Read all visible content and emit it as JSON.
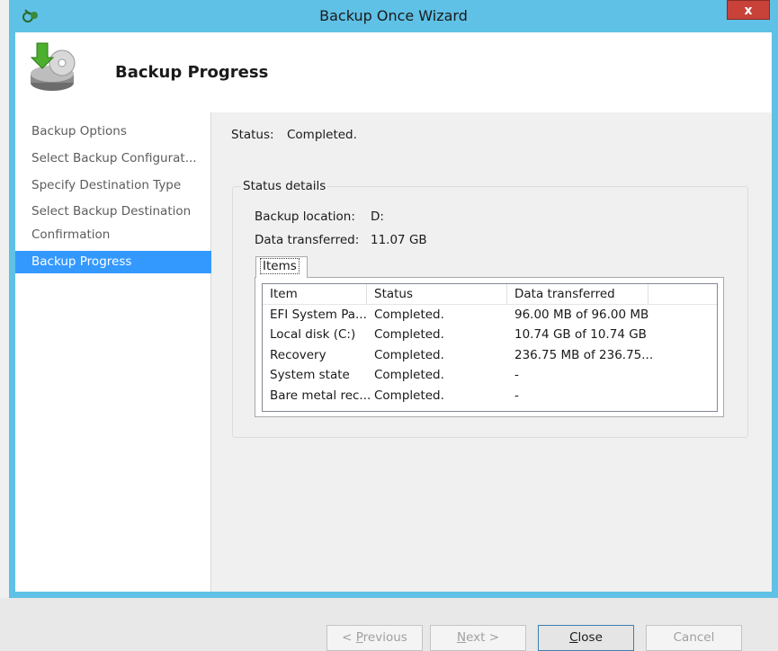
{
  "window": {
    "title": "Backup Once Wizard",
    "close_glyph": "x"
  },
  "header": {
    "title": "Backup Progress",
    "icon": "backup-disk-icon"
  },
  "sidebar": {
    "items": [
      {
        "label": "Backup Options"
      },
      {
        "label": "Select Backup Configurat..."
      },
      {
        "label": "Specify Destination Type"
      },
      {
        "label": "Select Backup Destination"
      },
      {
        "label": "Confirmation"
      },
      {
        "label": "Backup Progress",
        "active": true
      }
    ]
  },
  "status": {
    "label": "Status:",
    "value": "Completed."
  },
  "details": {
    "legend": "Status details",
    "location_label": "Backup location:",
    "location_value": "D:",
    "transferred_label": "Data transferred:",
    "transferred_value": "11.07 GB"
  },
  "tabs": {
    "items_label": "Items"
  },
  "table": {
    "columns": [
      "Item",
      "Status",
      "Data transferred"
    ],
    "rows": [
      [
        "EFI System Pa...",
        "Completed.",
        "96.00 MB of 96.00 MB"
      ],
      [
        "Local disk (C:)",
        "Completed.",
        "10.74 GB of 10.74 GB"
      ],
      [
        "Recovery",
        "Completed.",
        "236.75 MB of 236.75..."
      ],
      [
        "System state",
        "Completed.",
        "-"
      ],
      [
        "Bare metal rec...",
        "Completed.",
        "-"
      ]
    ]
  },
  "buttons": {
    "previous_prefix": "< ",
    "previous_key": "P",
    "previous_rest": "revious",
    "next_key": "N",
    "next_rest": "ext >",
    "close_key": "C",
    "close_rest": "lose",
    "cancel": "Cancel"
  },
  "colors": {
    "titlebar": "#5fc1e6",
    "selection": "#3399ff",
    "close": "#c8423a"
  }
}
